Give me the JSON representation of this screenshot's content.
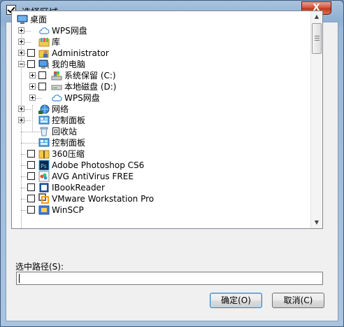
{
  "window": {
    "title": "选择区域",
    "close_label": "X"
  },
  "tree": {
    "items": [
      {
        "label": "桌面",
        "level": 0,
        "expander": "none",
        "checkbox": false,
        "icon": "desktop-icon"
      },
      {
        "label": "WPS网盘",
        "level": 1,
        "expander": "plus",
        "checkbox": false,
        "icon": "cloud-icon"
      },
      {
        "label": "库",
        "level": 1,
        "expander": "plus",
        "checkbox": false,
        "icon": "library-icon"
      },
      {
        "label": "Administrator",
        "level": 1,
        "expander": "plus",
        "checkbox": true,
        "icon": "user-folder-icon"
      },
      {
        "label": "我的电脑",
        "level": 1,
        "expander": "minus",
        "checkbox": true,
        "icon": "computer-icon"
      },
      {
        "label": "系统保留 (C:)",
        "level": 2,
        "expander": "plus",
        "checkbox": true,
        "icon": "system-drive-icon"
      },
      {
        "label": "本地磁盘 (D:)",
        "level": 2,
        "expander": "plus",
        "checkbox": true,
        "icon": "drive-icon"
      },
      {
        "label": "WPS网盘",
        "level": 2,
        "expander": "plus",
        "checkbox": false,
        "icon": "cloud-icon"
      },
      {
        "label": "网络",
        "level": 1,
        "expander": "plus",
        "checkbox": false,
        "icon": "network-icon"
      },
      {
        "label": "控制面板",
        "level": 1,
        "expander": "plus",
        "checkbox": false,
        "icon": "control-panel-icon"
      },
      {
        "label": "回收站",
        "level": 1,
        "expander": "none",
        "checkbox": false,
        "icon": "recycle-bin-icon"
      },
      {
        "label": "控制面板",
        "level": 1,
        "expander": "none",
        "checkbox": false,
        "icon": "control-panel-icon"
      },
      {
        "label": "360压缩",
        "level": 1,
        "expander": "none",
        "checkbox": true,
        "icon": "archive-folder-icon"
      },
      {
        "label": "Adobe Photoshop CS6",
        "level": 1,
        "expander": "none",
        "checkbox": true,
        "icon": "photoshop-icon"
      },
      {
        "label": "AVG AntiVirus FREE",
        "level": 1,
        "expander": "none",
        "checkbox": true,
        "icon": "avg-icon"
      },
      {
        "label": "IBookReader",
        "level": 1,
        "expander": "none",
        "checkbox": true,
        "icon": "book-reader-icon"
      },
      {
        "label": "VMware Workstation Pro",
        "level": 1,
        "expander": "none",
        "checkbox": true,
        "icon": "vmware-icon"
      },
      {
        "label": "WinSCP",
        "level": 1,
        "expander": "none",
        "checkbox": true,
        "icon": "winscp-icon"
      }
    ]
  },
  "path": {
    "label": "选中路径(S):",
    "value": ""
  },
  "buttons": {
    "ok": "确定(O)",
    "cancel": "取消(C)"
  },
  "colors": {
    "title_bar": "#a9c2dd",
    "close": "#c3381c",
    "accent": "#3c7fb1"
  }
}
